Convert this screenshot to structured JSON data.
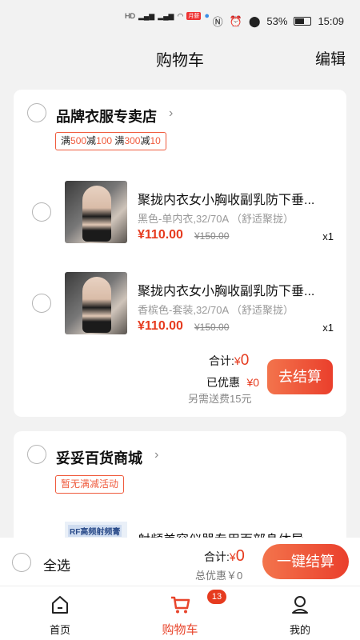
{
  "status_bar": {
    "left_icons": [
      "HD",
      "4G",
      "4G",
      "wifi-icon",
      "app-badge-icon",
      "shield-icon"
    ],
    "app_badge_text": "月薪",
    "battery": "53%",
    "time": "15:09"
  },
  "header": {
    "title": "购物车",
    "edit": "编辑"
  },
  "shops": [
    {
      "name": "品牌衣服专卖店",
      "promo": {
        "p1": "满",
        "v1": "500",
        "p2": "减",
        "v2": "100",
        "p3": " 满",
        "v3": "300",
        "p4": "减",
        "v4": "10"
      },
      "items": [
        {
          "title": "聚拢内衣女小胸收副乳防下垂...",
          "spec": "黑色-单内衣,32/70A （舒适聚拢）",
          "price": "¥110.00",
          "orig": "¥150.00",
          "qty": "x1"
        },
        {
          "title": "聚拢内衣女小胸收副乳防下垂...",
          "spec": "香槟色-套装,32/70A （舒适聚拢）",
          "price": "¥110.00",
          "orig": "¥150.00",
          "qty": "x1"
        }
      ],
      "total_label": "合计:",
      "total_currency": "¥",
      "total_value": "0",
      "discount_label": "已优惠",
      "discount_value": "¥0",
      "shipping_note": "另需送费15元",
      "checkout": "去结算"
    },
    {
      "name": "妥妥百货商城",
      "promo_text": "暂无满减活动",
      "items": [
        {
          "title": "射频美容仪器专用面部身体导",
          "thumb_text": "RF高频射频膏"
        }
      ]
    }
  ],
  "bottom": {
    "select_all": "全选",
    "total_label": "合计:",
    "total_currency": "¥",
    "total_value": "0",
    "discount_total": "总优惠￥0",
    "checkout_all": "一键结算"
  },
  "tabs": [
    {
      "label": "首页",
      "icon": "home-icon"
    },
    {
      "label": "购物车",
      "icon": "cart-icon",
      "badge": "13"
    },
    {
      "label": "我的",
      "icon": "profile-icon"
    }
  ],
  "colors": {
    "accent": "#e63b1f",
    "button_start": "#f3744c",
    "button_end": "#ea3f2c",
    "active_tab": "#e8452c"
  }
}
